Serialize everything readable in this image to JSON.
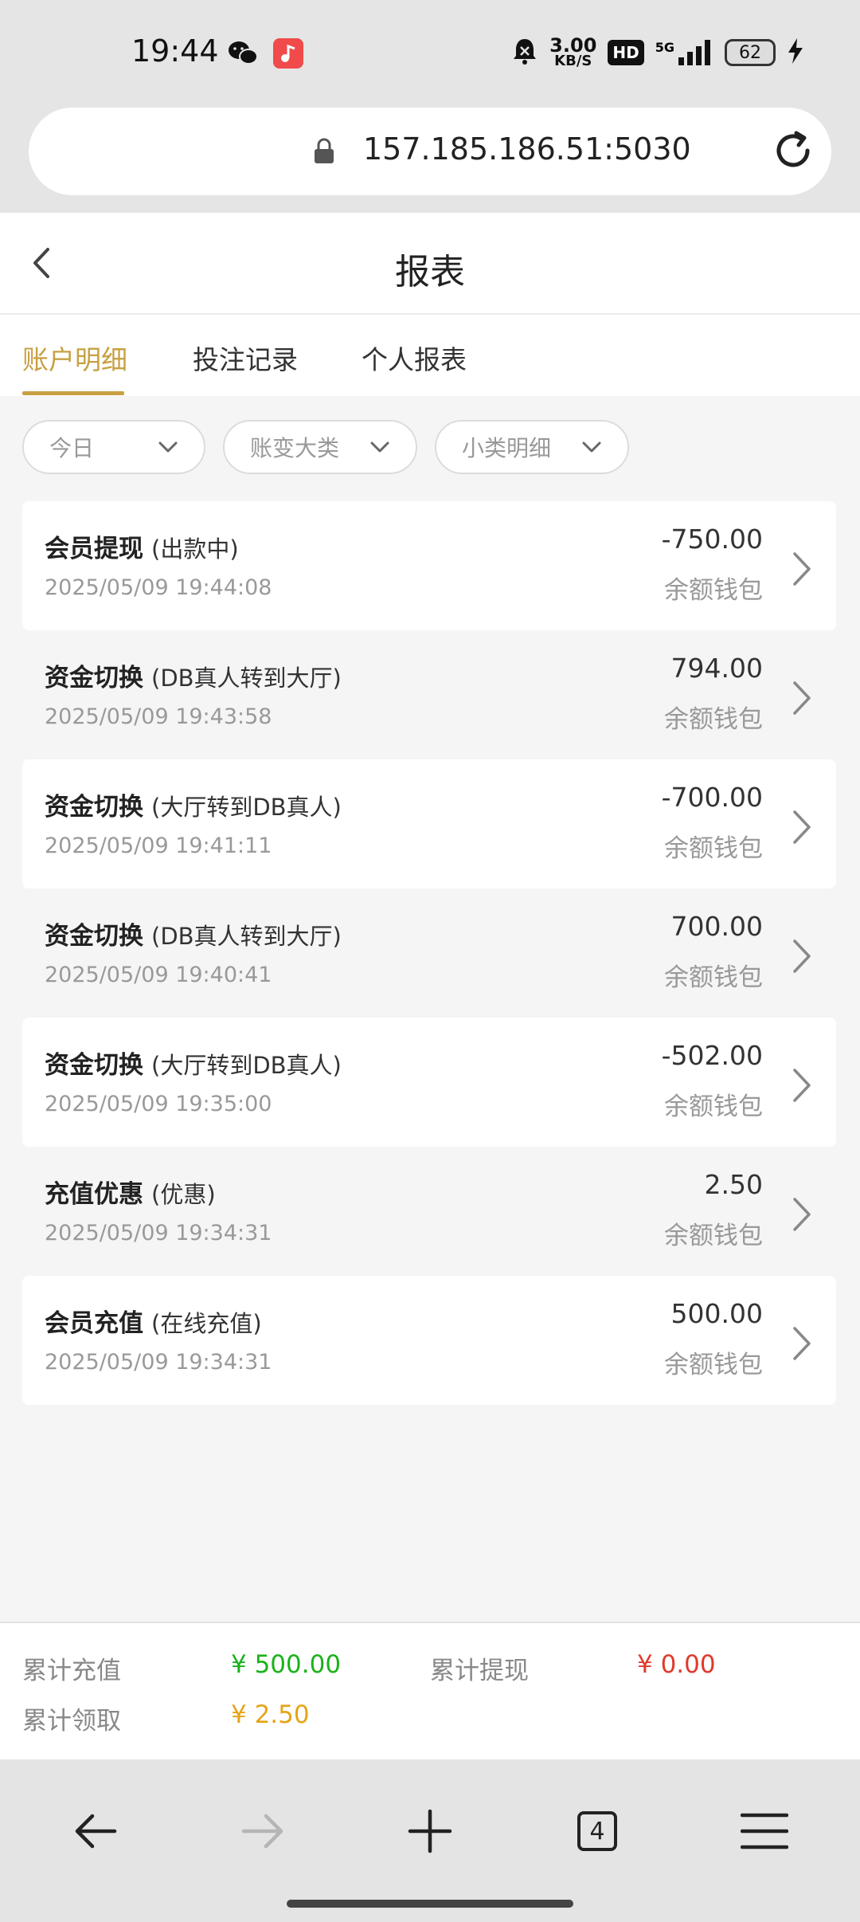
{
  "status_bar": {
    "time": "19:44",
    "net_speed_value": "3.00",
    "net_speed_unit": "KB/S",
    "hd": "HD",
    "network": "5G",
    "battery": "62",
    "icons": [
      "wechat-icon",
      "music-app-icon",
      "alarm-off-icon",
      "signal-icon",
      "charging-icon"
    ]
  },
  "browser": {
    "url": "157.185.186.51:5030"
  },
  "header": {
    "title": "报表"
  },
  "tabs": [
    {
      "label": "账户明细",
      "active": true
    },
    {
      "label": "投注记录",
      "active": false
    },
    {
      "label": "个人报表",
      "active": false
    }
  ],
  "filters": [
    {
      "label": "今日"
    },
    {
      "label": "账变大类"
    },
    {
      "label": "小类明细"
    }
  ],
  "records": [
    {
      "title": "会员提现",
      "sub": "(出款中)",
      "time": "2025/05/09 19:44:08",
      "amount": "-750.00",
      "wallet": "余额钱包"
    },
    {
      "title": "资金切换",
      "sub": "(DB真人转到大厅)",
      "time": "2025/05/09 19:43:58",
      "amount": "794.00",
      "wallet": "余额钱包"
    },
    {
      "title": "资金切换",
      "sub": "(大厅转到DB真人)",
      "time": "2025/05/09 19:41:11",
      "amount": "-700.00",
      "wallet": "余额钱包"
    },
    {
      "title": "资金切换",
      "sub": "(DB真人转到大厅)",
      "time": "2025/05/09 19:40:41",
      "amount": "700.00",
      "wallet": "余额钱包"
    },
    {
      "title": "资金切换",
      "sub": "(大厅转到DB真人)",
      "time": "2025/05/09 19:35:00",
      "amount": "-502.00",
      "wallet": "余额钱包"
    },
    {
      "title": "充值优惠",
      "sub": "(优惠)",
      "time": "2025/05/09 19:34:31",
      "amount": "2.50",
      "wallet": "余额钱包"
    },
    {
      "title": "会员充值",
      "sub": "(在线充值)",
      "time": "2025/05/09 19:34:31",
      "amount": "500.00",
      "wallet": "余额钱包"
    }
  ],
  "summary": {
    "recharge_label": "累计充值",
    "recharge_value": "¥ 500.00",
    "withdraw_label": "累计提现",
    "withdraw_value": "¥ 0.00",
    "claim_label": "累计领取",
    "claim_value": "¥ 2.50"
  },
  "bottom_nav": {
    "tab_count": "4"
  },
  "colors": {
    "accent": "#c7a042",
    "positive": "#1bb21b",
    "negative": "#e03a2b",
    "bonus": "#e6a417"
  }
}
